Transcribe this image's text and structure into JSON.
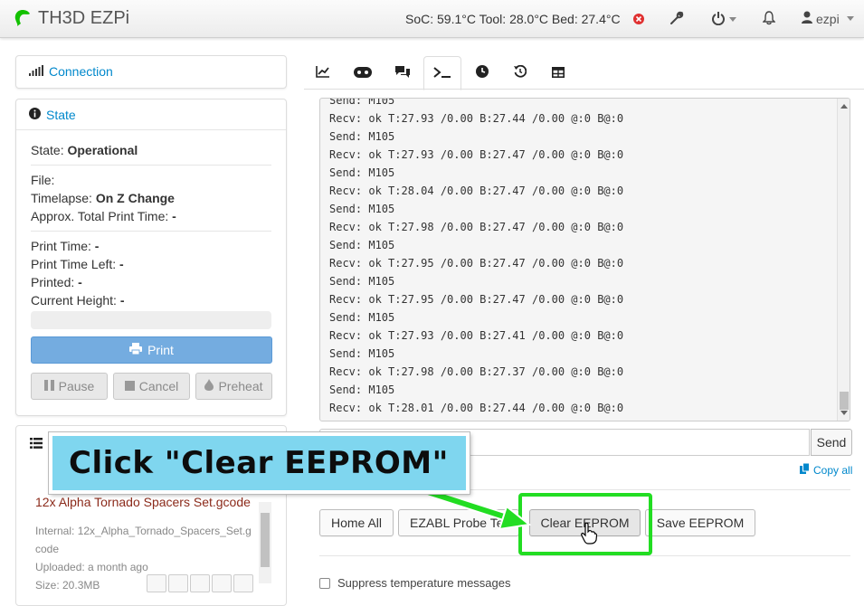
{
  "navbar": {
    "brand": "TH3D EZPi",
    "status": "SoC: 59.1°C Tool: 28.0°C Bed: 27.4°C",
    "user": "ezpi",
    "icons": [
      "octopus-logo",
      "error-icon",
      "wrench-icon",
      "power-icon",
      "bell-icon",
      "user-icon"
    ]
  },
  "sidebar": {
    "connection_label": "Connection",
    "state_label": "State",
    "state": {
      "label": "State:",
      "value": "Operational"
    },
    "file": {
      "label": "File:",
      "value": ""
    },
    "timelapse": {
      "label": "Timelapse:",
      "value": "On Z Change"
    },
    "approx_total": {
      "label": "Approx. Total Print Time:",
      "value": "-"
    },
    "print_time": {
      "label": "Print Time:",
      "value": "-"
    },
    "print_time_left": {
      "label": "Print Time Left:",
      "value": "-"
    },
    "printed": {
      "label": "Printed:",
      "value": "-"
    },
    "current_height": {
      "label": "Current Height:",
      "value": "-"
    },
    "progress": 0,
    "buttons": {
      "print": "Print",
      "pause": "Pause",
      "cancel": "Cancel",
      "preheat": "Preheat"
    }
  },
  "files": {
    "file_name": "12x Alpha Tornado Spacers Set.gcode",
    "internal_1": "Internal: 12x_Alpha_Tornado_Spacers_Set.g",
    "internal_2": "code",
    "uploaded": "Uploaded: a month ago",
    "size": "Size: 20.3MB"
  },
  "tabs": [
    "graph-tab",
    "control-tab",
    "gcode-viewer-tab",
    "terminal-tab",
    "timelapse-tab",
    "history-tab",
    "table-tab"
  ],
  "terminal": {
    "lines": [
      "Send: M105",
      "Recv: ok T:27.93 /0.00 B:27.44 /0.00 @:0 B@:0",
      "Send: M105",
      "Recv: ok T:27.93 /0.00 B:27.47 /0.00 @:0 B@:0",
      "Send: M105",
      "Recv: ok T:28.04 /0.00 B:27.47 /0.00 @:0 B@:0",
      "Send: M105",
      "Recv: ok T:27.98 /0.00 B:27.47 /0.00 @:0 B@:0",
      "Send: M105",
      "Recv: ok T:27.95 /0.00 B:27.47 /0.00 @:0 B@:0",
      "Send: M105",
      "Recv: ok T:27.95 /0.00 B:27.47 /0.00 @:0 B@:0",
      "Send: M105",
      "Recv: ok T:27.93 /0.00 B:27.41 /0.00 @:0 B@:0",
      "Send: M105",
      "Recv: ok T:27.98 /0.00 B:27.37 /0.00 @:0 B@:0",
      "Send: M105",
      "Recv: ok T:28.01 /0.00 B:27.44 /0.00 @:0 B@:0"
    ],
    "input_value": "",
    "send": "Send",
    "copy_all": "Copy all"
  },
  "actions": {
    "home_all": "Home All",
    "ezabl_probe_test": "EZABL Probe Test",
    "clear_eeprom": "Clear EEPROM",
    "save_eeprom": "Save EEPROM"
  },
  "suppress": "Suppress temperature messages",
  "callout": "Click \"Clear EEPROM\"",
  "colors": {
    "accent": "#0088cc",
    "highlight": "#22dd22",
    "callout_bg": "#7fd6ef",
    "print_button": "#74ace0"
  }
}
